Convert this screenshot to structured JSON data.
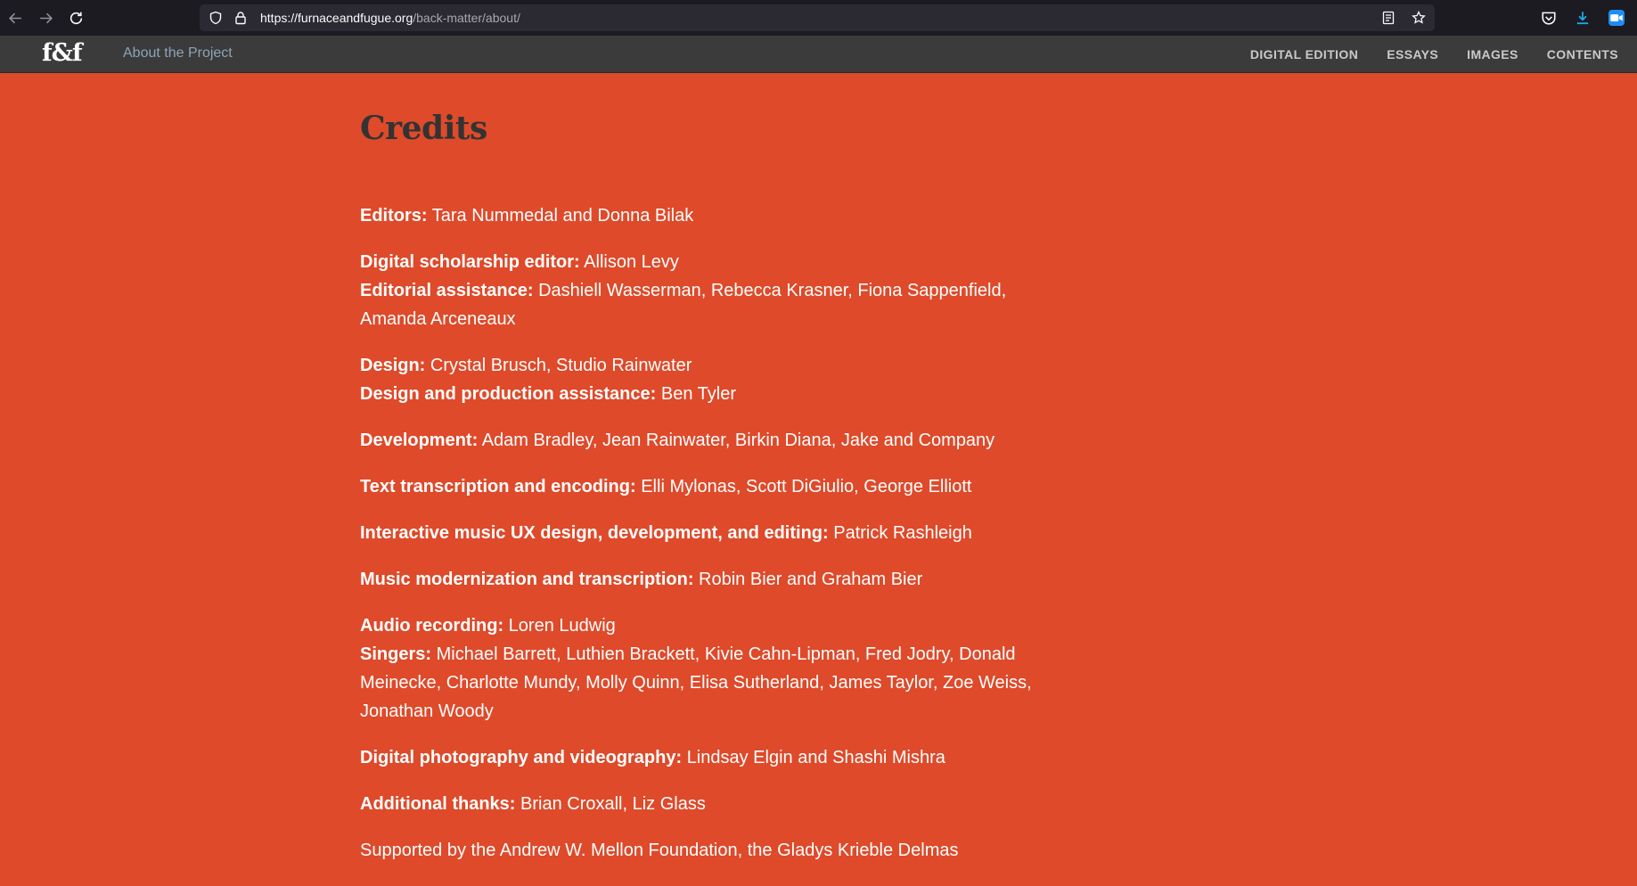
{
  "browser": {
    "url_host": "https://furnaceandfugue.org",
    "url_path": "/back-matter/about/"
  },
  "site": {
    "logo": "f&f",
    "crumb": "About the Project",
    "nav": [
      "DIGITAL EDITION",
      "ESSAYS",
      "IMAGES",
      "CONTENTS"
    ]
  },
  "page": {
    "title": "Credits",
    "groups": [
      [
        {
          "role": "Editors:",
          "names": "Tara Nummedal and Donna Bilak"
        }
      ],
      [
        {
          "role": "Digital scholarship editor:",
          "names": "Allison Levy"
        },
        {
          "role": "Editorial assistance:",
          "names": "Dashiell Wasserman, Rebecca Krasner, Fiona Sappenfield, Amanda Arceneaux"
        }
      ],
      [
        {
          "role": "Design:",
          "names": "Crystal Brusch, Studio Rainwater"
        },
        {
          "role": "Design and production assistance:",
          "names": "Ben Tyler"
        }
      ],
      [
        {
          "role": "Development:",
          "names": "Adam Bradley, Jean Rainwater, Birkin Diana, Jake and Company"
        }
      ],
      [
        {
          "role": "Text transcription and encoding:",
          "names": "Elli Mylonas, Scott DiGiulio, George Elliott"
        }
      ],
      [
        {
          "role": "Interactive music UX design, development, and editing:",
          "names": "Patrick Rashleigh"
        }
      ],
      [
        {
          "role": "Music modernization and transcription:",
          "names": "Robin Bier and Graham Bier"
        }
      ],
      [
        {
          "role": "Audio recording:",
          "names": "Loren Ludwig"
        },
        {
          "role": "Singers:",
          "names": "Michael Barrett, Luthien Brackett, Kivie Cahn-Lipman, Fred Jodry, Donald Meinecke, Charlotte Mundy, Molly Quinn, Elisa Sutherland, James Taylor, Zoe Weiss, Jonathan Woody"
        }
      ],
      [
        {
          "role": "Digital photography and videography:",
          "names": "Lindsay Elgin and Shashi Mishra"
        }
      ],
      [
        {
          "role": "Additional thanks:",
          "names": "Brian Croxall, Liz Glass"
        }
      ]
    ],
    "support": "Supported by the Andrew W. Mellon Foundation, the Gladys Krieble Delmas"
  }
}
